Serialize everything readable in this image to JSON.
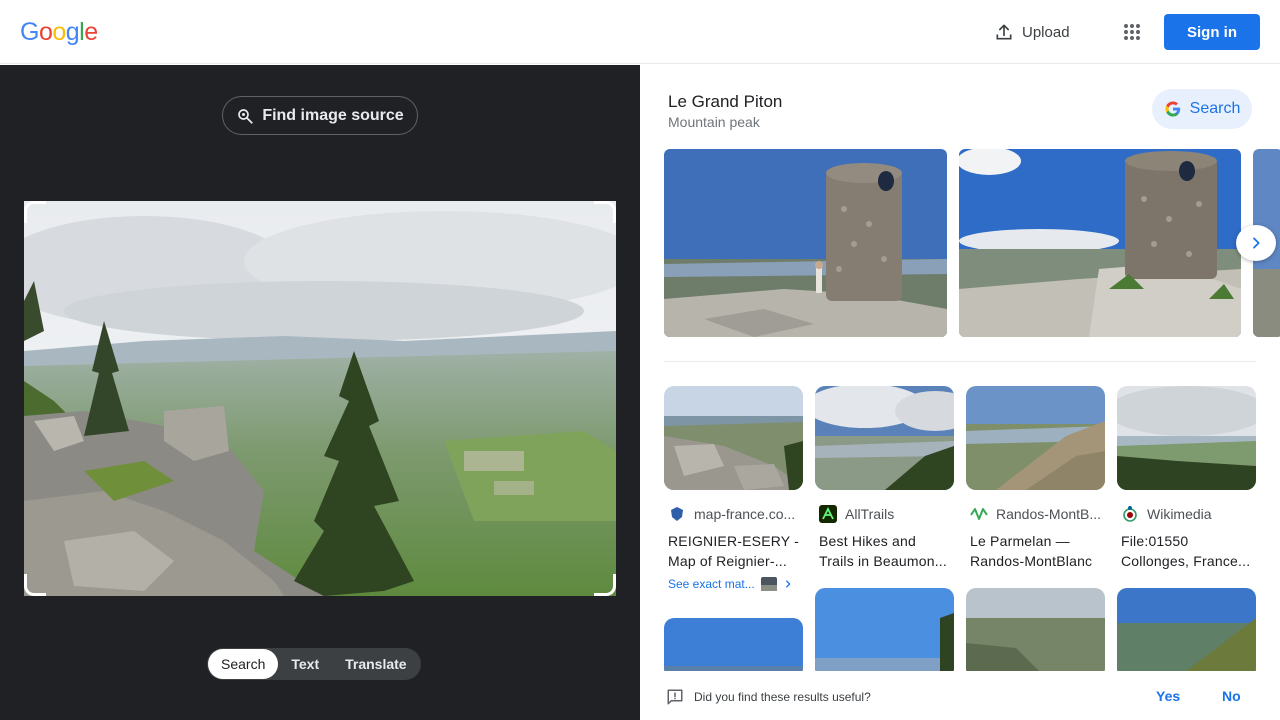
{
  "header": {
    "logo_letters": [
      "G",
      "o",
      "o",
      "g",
      "l",
      "e"
    ],
    "upload_label": "Upload",
    "signin_label": "Sign in"
  },
  "left_pane": {
    "find_source_label": "Find image source",
    "tabs": [
      {
        "label": "Search",
        "active": true
      },
      {
        "label": "Text",
        "active": false
      },
      {
        "label": "Translate",
        "active": false
      }
    ]
  },
  "knowledge_panel": {
    "title": "Le Grand Piton",
    "subtitle": "Mountain peak",
    "search_label": "Search"
  },
  "results": [
    {
      "source": "map-france.co...",
      "title_line1": "REIGNIER-ESERY -",
      "title_line2": "Map of Reignier-...",
      "see_exact": "See exact mat..."
    },
    {
      "source": "AllTrails",
      "title_line1": "Best Hikes and",
      "title_line2": "Trails in Beaumon..."
    },
    {
      "source": "Randos-MontB...",
      "title_line1": "Le Parmelan —",
      "title_line2": "Randos-MontBlanc"
    },
    {
      "source": "Wikimedia",
      "title_line1": "File:01550",
      "title_line2": "Collonges, France..."
    }
  ],
  "feedback": {
    "question": "Did you find these results useful?",
    "yes": "Yes",
    "no": "No"
  },
  "colors": {
    "accent": "#1a73e8",
    "dark_bg": "#202124"
  }
}
